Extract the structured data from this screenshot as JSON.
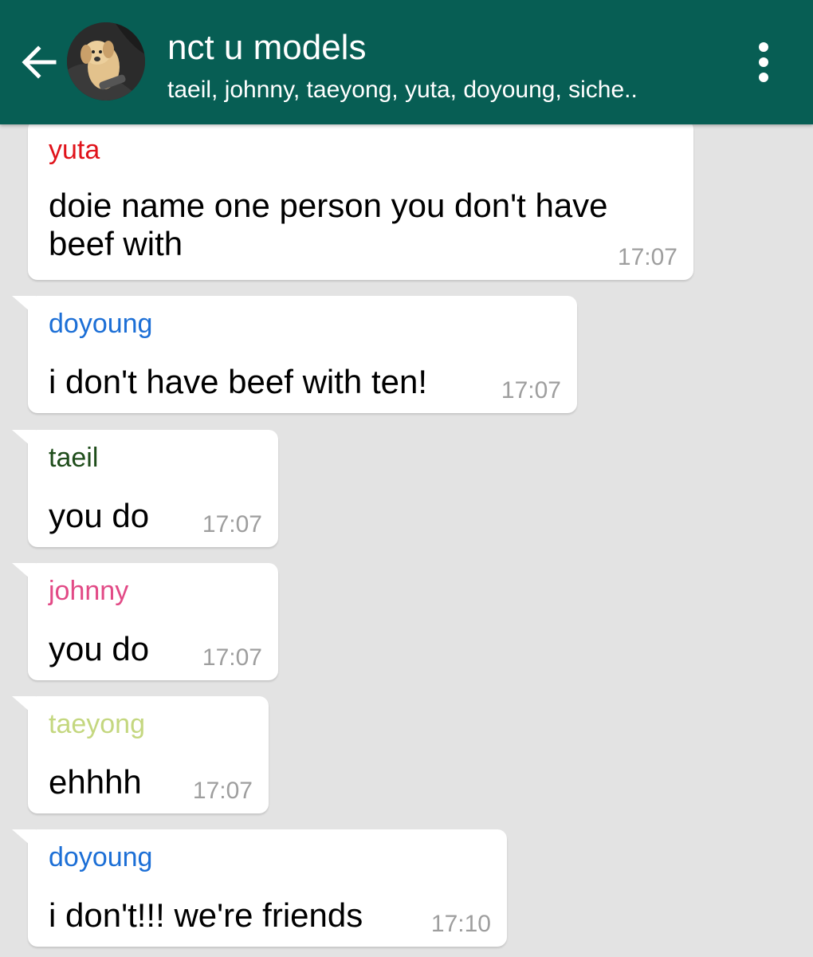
{
  "header": {
    "title": "nct u models",
    "subtitle": "taeil, johnny, taeyong, yuta, doyoung, siche..",
    "back_icon": "arrow-left-icon",
    "menu_icon": "more-vertical-icon",
    "color": "#075e54"
  },
  "messages": [
    {
      "sender": "yuta",
      "sender_color": "#e0131b",
      "text": "doie name one person you don't have beef with",
      "time": "17:07"
    },
    {
      "sender": "doyoung",
      "sender_color": "#1c6fd6",
      "text": "i don't have beef with ten!",
      "time": "17:07"
    },
    {
      "sender": "taeil",
      "sender_color": "#1f4d1b",
      "text": "you do",
      "time": "17:07"
    },
    {
      "sender": "johnny",
      "sender_color": "#e24a86",
      "text": "you do",
      "time": "17:07"
    },
    {
      "sender": "taeyong",
      "sender_color": "#c4d77f",
      "text": "ehhhh",
      "time": "17:07"
    },
    {
      "sender": "doyoung",
      "sender_color": "#1c6fd6",
      "text": "i don't!!! we're friends",
      "time": "17:10"
    }
  ]
}
